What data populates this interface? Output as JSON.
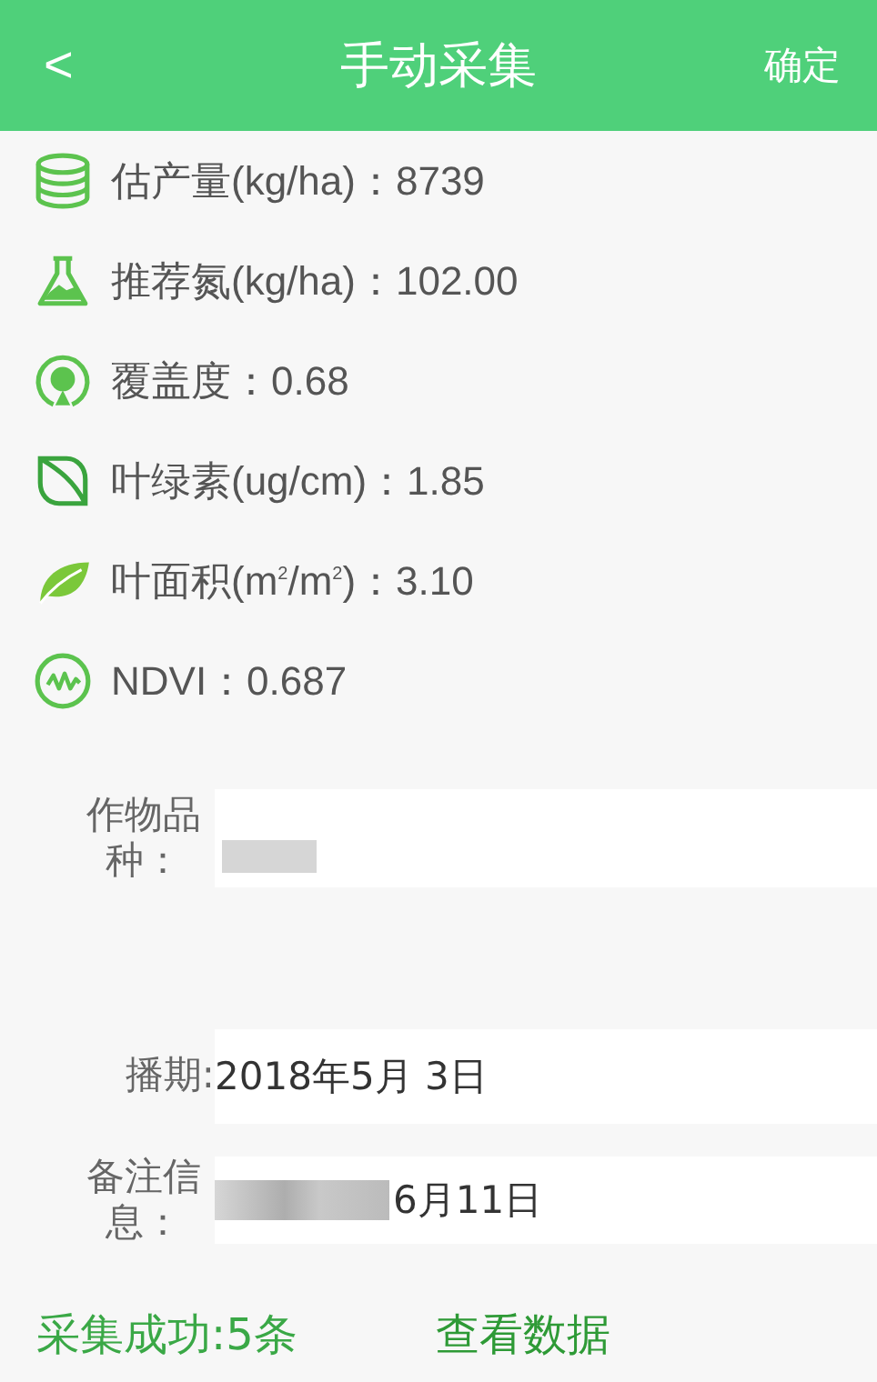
{
  "header": {
    "back": "<",
    "title": "手动采集",
    "confirm": "确定"
  },
  "metrics": [
    {
      "kind": "database",
      "text": "估产量(kg/ha)：8739"
    },
    {
      "kind": "flask",
      "text": "推荐氮(kg/ha)：102.00"
    },
    {
      "kind": "target",
      "text": "覆盖度：0.68"
    },
    {
      "kind": "leaf-outline",
      "text": "叶绿素(ug/cm)：1.85"
    },
    {
      "kind": "leaf-solid",
      "text": "叶面积(m$^{2}$/m$^{2}$)：3.10"
    },
    {
      "kind": "wave",
      "text": "NDVI：0.687"
    }
  ],
  "form": [
    {
      "label": "作物品种：",
      "redacted": true
    },
    {
      "label": "播期:",
      "value": "2018年5月 3日"
    },
    {
      "label": "备注信息：",
      "value": "6月11日",
      "redacted": true
    }
  ],
  "footer": {
    "status": "采集成功:5条",
    "link": "查看数据"
  }
}
